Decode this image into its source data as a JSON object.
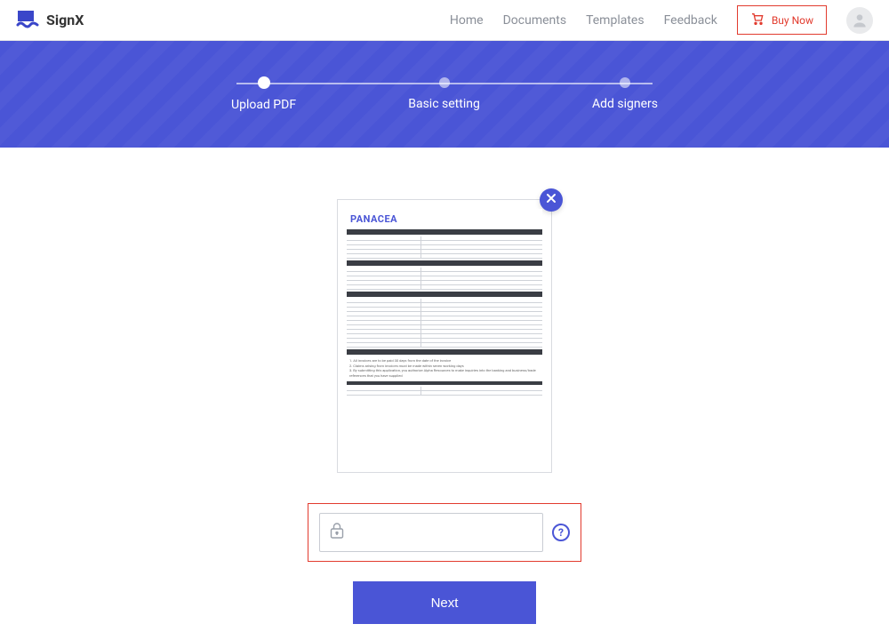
{
  "brand": {
    "name": "SignX"
  },
  "nav": {
    "home": "Home",
    "documents": "Documents",
    "templates": "Templates",
    "feedback": "Feedback",
    "buy": "Buy Now"
  },
  "stepper": {
    "steps": [
      {
        "label": "Upload PDF",
        "active": true
      },
      {
        "label": "Basic setting",
        "active": false
      },
      {
        "label": "Add signers",
        "active": false
      }
    ]
  },
  "document": {
    "preview_title": "PANACEA"
  },
  "password": {
    "value": "",
    "placeholder": ""
  },
  "actions": {
    "next": "Next"
  }
}
